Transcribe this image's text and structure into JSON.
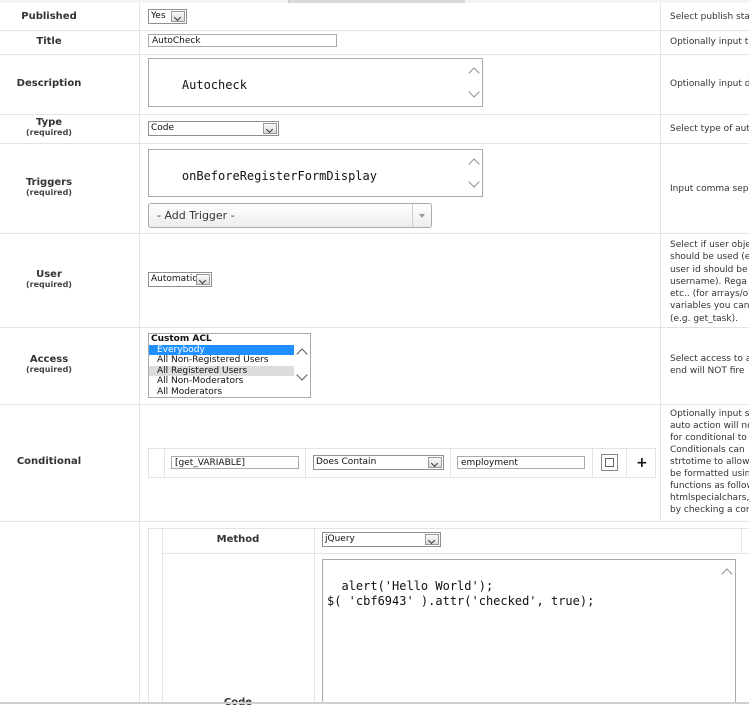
{
  "rows": {
    "published": {
      "label": "Published",
      "value": "Yes",
      "help": "Select publish sta"
    },
    "title": {
      "label": "Title",
      "value": "AutoCheck",
      "help": "Optionally input ti"
    },
    "description": {
      "label": "Description",
      "value": "Autocheck",
      "help": "Optionally input d"
    },
    "type": {
      "label": "Type",
      "required": "(required)",
      "value": "Code",
      "help": "Select type of aut"
    },
    "triggers": {
      "label": "Triggers",
      "required": "(required)",
      "value": "onBeforeRegisterFormDisplay",
      "add_trigger": "- Add Trigger -",
      "help": "Input comma sep"
    },
    "user": {
      "label": "User",
      "required": "(required)",
      "value": "Automatic",
      "help": [
        "Select if user obje",
        "should be used (e",
        "user id should be",
        "username). Rega",
        "etc.. (for arrays/o",
        "variables you can",
        "(e.g. get_task)."
      ]
    },
    "access": {
      "label": "Access",
      "required": "(required)",
      "group": "Custom ACL",
      "options": [
        "Everybody",
        "All Non-Registered Users",
        "All Registered Users",
        "All Non-Moderators",
        "All Moderators"
      ],
      "help": [
        "Select access to a",
        "end will NOT fire"
      ]
    },
    "conditional": {
      "label": "Conditional",
      "field": "[get_VARIABLE]",
      "operator": "Does Contain",
      "value": "employment",
      "add": "+",
      "help": [
        "Optionally input s",
        "auto action will no",
        "for conditional to",
        "Conditionals can",
        "strtotime to allow",
        "be formatted usin",
        "functions as follow",
        "htmlspecialchars,",
        "by checking a cor"
      ]
    },
    "method": {
      "label": "Method",
      "value": "jQuery"
    },
    "code": {
      "label": "Code",
      "value": "alert('Hello World');\n$( 'cbf6943' ).attr('checked', true);"
    }
  }
}
